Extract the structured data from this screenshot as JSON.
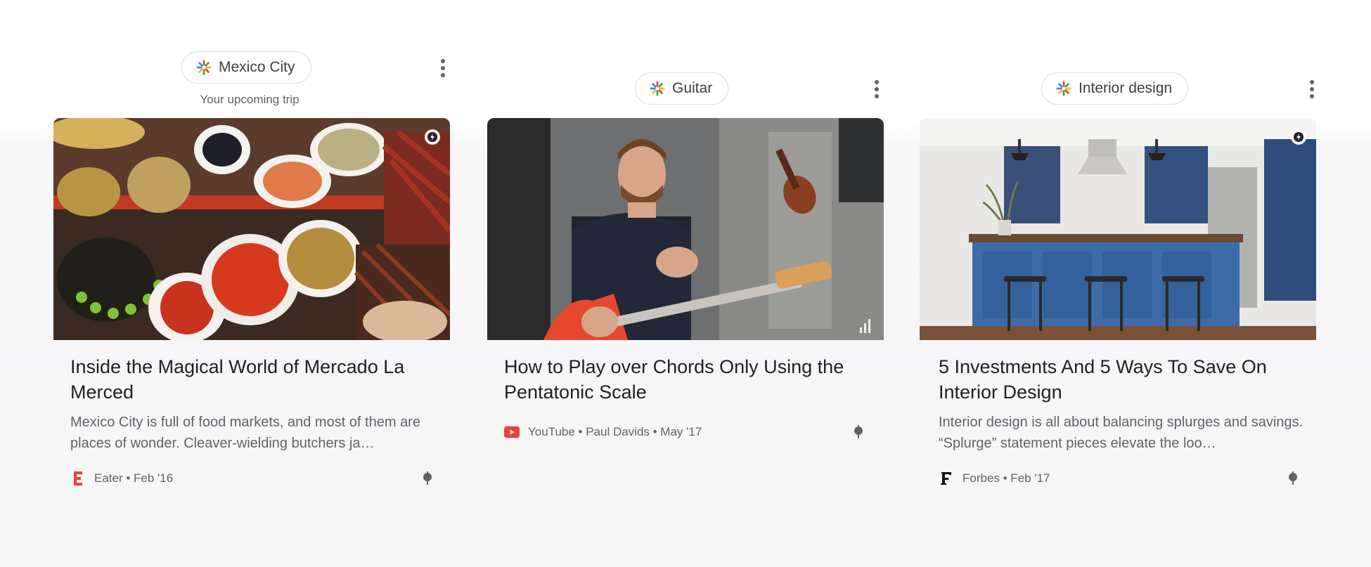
{
  "colors": {
    "chip_border": "#dadce0",
    "title_text": "#202124",
    "secondary_text": "#5f6368",
    "youtube_red": "#ea4335",
    "eater_red": "#e8452c"
  },
  "cards": [
    {
      "chip_label": "Mexico City",
      "chip_subtitle": "Your upcoming trip",
      "title": "Inside the Magical World of Mercado La Merced",
      "snippet": "Mexico City is full of food markets, and most of them are places of wonder. Cleaver-wielding butchers ja…",
      "source_icon": "eater-logo-icon",
      "source_meta": "Eater • Feb '16",
      "image_subject": "market-food-image",
      "badge": "amp-lightning-icon"
    },
    {
      "chip_label": "Guitar",
      "title": "How to Play over Chords Only Using the Pentatonic Scale",
      "source_icon": "youtube-play-icon",
      "source_meta": "YouTube • Paul Davids • May '17",
      "image_subject": "guitar-video-thumbnail",
      "badge": "video-bars-icon"
    },
    {
      "chip_label": "Interior design",
      "title": "5 Investments And 5 Ways To Save On Interior Design",
      "snippet": "Interior design is all about balancing splurges and savings. “Splurge” statement pieces elevate the loo…",
      "source_icon": "forbes-logo-icon",
      "source_meta": "Forbes • Feb '17",
      "image_subject": "kitchen-interior-image",
      "badge": "amp-lightning-icon"
    }
  ]
}
